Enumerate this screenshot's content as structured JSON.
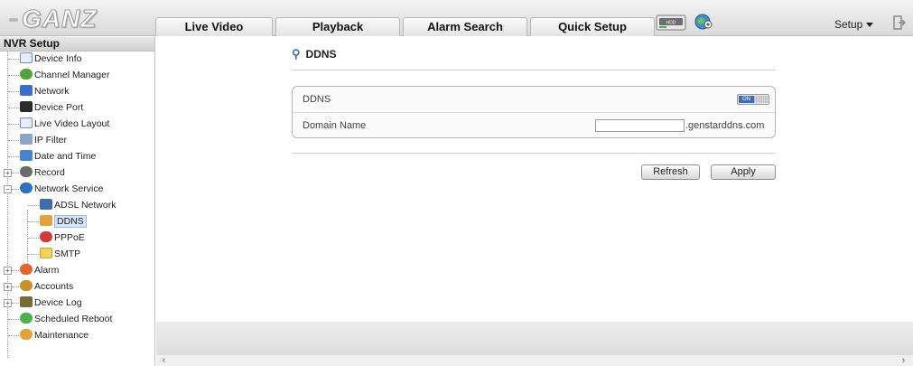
{
  "header": {
    "logo_text": "GANZ",
    "tabs": [
      "Live Video",
      "Playback",
      "Alarm Search",
      "Quick Setup"
    ],
    "hdd_icon_label": "HDD",
    "setup_menu": "Setup"
  },
  "sidebar": {
    "title": "NVR Setup",
    "items": [
      {
        "label": "Device Info",
        "icon": "device-info-icon"
      },
      {
        "label": "Channel Manager",
        "icon": "channel-manager-icon"
      },
      {
        "label": "Network",
        "icon": "network-icon"
      },
      {
        "label": "Device Port",
        "icon": "device-port-icon"
      },
      {
        "label": "Live Video Layout",
        "icon": "live-video-layout-icon"
      },
      {
        "label": "IP Filter",
        "icon": "ip-filter-icon"
      },
      {
        "label": "Date and Time",
        "icon": "date-time-icon"
      },
      {
        "label": "Record",
        "icon": "record-icon"
      },
      {
        "label": "Network Service",
        "icon": "network-service-icon"
      },
      {
        "label": "ADSL Network",
        "icon": "adsl-network-icon"
      },
      {
        "label": "DDNS",
        "icon": "ddns-icon"
      },
      {
        "label": "PPPoE",
        "icon": "pppoe-icon"
      },
      {
        "label": "SMTP",
        "icon": "smtp-icon"
      },
      {
        "label": "Alarm",
        "icon": "alarm-icon"
      },
      {
        "label": "Accounts",
        "icon": "accounts-icon"
      },
      {
        "label": "Device Log",
        "icon": "device-log-icon"
      },
      {
        "label": "Scheduled Reboot",
        "icon": "scheduled-reboot-icon"
      },
      {
        "label": "Maintenance",
        "icon": "maintenance-icon"
      }
    ]
  },
  "content": {
    "title": "DDNS",
    "rows": {
      "ddns_label": "DDNS",
      "ddns_toggle_on": "ON",
      "domain_label": "Domain Name",
      "domain_value": "",
      "domain_suffix": ".genstarddns.com"
    },
    "buttons": {
      "refresh": "Refresh",
      "apply": "Apply"
    }
  },
  "colors": {
    "accent": "#3e6db8",
    "selection": "#d7e6fb"
  }
}
